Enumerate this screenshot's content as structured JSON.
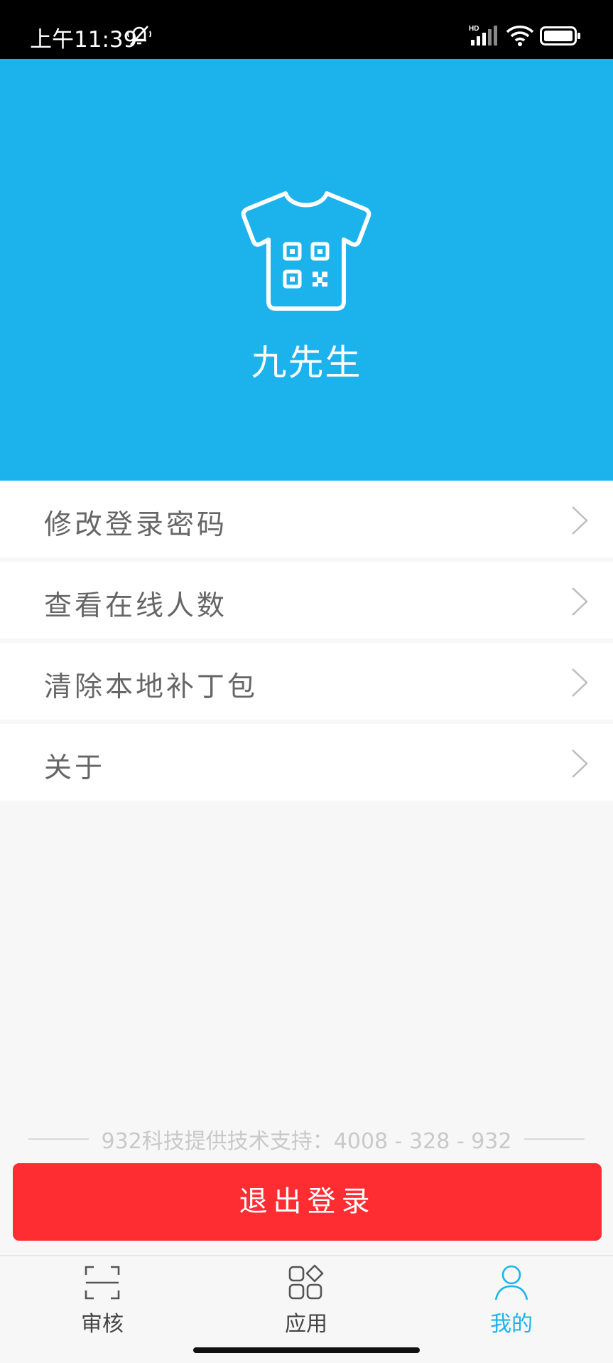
{
  "status_bar": {
    "time": "上午11:39",
    "icons": [
      "mute-icon",
      "hd-signal-icon",
      "wifi-icon",
      "battery-icon"
    ]
  },
  "header": {
    "username": "九先生",
    "logo_icon": "tshirt-qr-icon",
    "background_color": "#1cb3ec"
  },
  "menu": {
    "items": [
      {
        "label": "修改登录密码",
        "icon": "chevron-right-icon"
      },
      {
        "label": "查看在线人数",
        "icon": "chevron-right-icon"
      },
      {
        "label": "清除本地补丁包",
        "icon": "chevron-right-icon"
      },
      {
        "label": "关于",
        "icon": "chevron-right-icon"
      }
    ]
  },
  "support_text": "932科技提供技术支持：4008 - 328 - 932",
  "logout": {
    "label": "退出登录",
    "color": "#fd2d32"
  },
  "tabbar": {
    "tabs": [
      {
        "label": "审核",
        "icon": "scan-icon",
        "active": false
      },
      {
        "label": "应用",
        "icon": "apps-icon",
        "active": false
      },
      {
        "label": "我的",
        "icon": "user-icon",
        "active": true
      }
    ],
    "active_color": "#1cb3ec"
  }
}
